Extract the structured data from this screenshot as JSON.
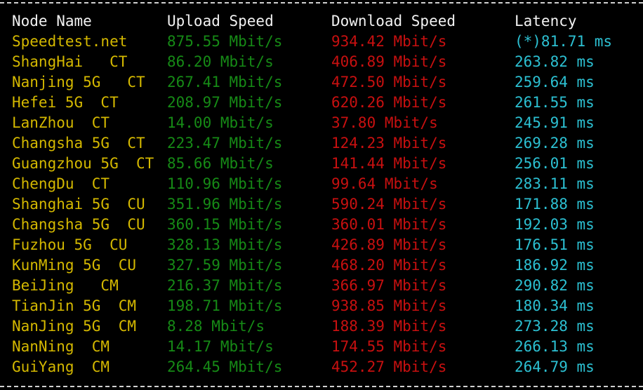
{
  "colors": {
    "node": "#d4b800",
    "upload": "#168a16",
    "download": "#c81010",
    "latency": "#2cc0d2",
    "header": "#f2f2f2"
  },
  "header": {
    "node": "Node Name",
    "upload": "Upload Speed",
    "download": "Download Speed",
    "latency": "Latency"
  },
  "rows": [
    {
      "node": "Speedtest.net",
      "upload": "875.55 Mbit/s",
      "download": "934.42 Mbit/s",
      "latency": "(*)81.71 ms"
    },
    {
      "node": "ShangHai   CT",
      "upload": "86.20 Mbit/s",
      "download": "406.89 Mbit/s",
      "latency": "263.82 ms"
    },
    {
      "node": "Nanjing 5G   CT",
      "upload": "267.41 Mbit/s",
      "download": "472.50 Mbit/s",
      "latency": "259.64 ms"
    },
    {
      "node": "Hefei 5G  CT",
      "upload": "208.97 Mbit/s",
      "download": "620.26 Mbit/s",
      "latency": "261.55 ms"
    },
    {
      "node": "LanZhou  CT",
      "upload": "14.00 Mbit/s",
      "download": "37.80 Mbit/s",
      "latency": "245.91 ms"
    },
    {
      "node": "Changsha 5G  CT",
      "upload": "223.47 Mbit/s",
      "download": "124.23 Mbit/s",
      "latency": "269.28 ms"
    },
    {
      "node": "Guangzhou 5G  CT",
      "upload": "85.66 Mbit/s",
      "download": "141.44 Mbit/s",
      "latency": "256.01 ms"
    },
    {
      "node": "ChengDu  CT",
      "upload": "110.96 Mbit/s",
      "download": "99.64 Mbit/s",
      "latency": "283.11 ms"
    },
    {
      "node": "Shanghai 5G  CU",
      "upload": "351.96 Mbit/s",
      "download": "590.24 Mbit/s",
      "latency": "171.88 ms"
    },
    {
      "node": "Changsha 5G  CU",
      "upload": "360.15 Mbit/s",
      "download": "360.01 Mbit/s",
      "latency": "192.03 ms"
    },
    {
      "node": "Fuzhou 5G  CU",
      "upload": "328.13 Mbit/s",
      "download": "426.89 Mbit/s",
      "latency": "176.51 ms"
    },
    {
      "node": "KunMing 5G  CU",
      "upload": "327.59 Mbit/s",
      "download": "468.20 Mbit/s",
      "latency": "186.92 ms"
    },
    {
      "node": "BeiJing   CM",
      "upload": "216.37 Mbit/s",
      "download": "366.97 Mbit/s",
      "latency": "290.82 ms"
    },
    {
      "node": "TianJin 5G  CM",
      "upload": "198.71 Mbit/s",
      "download": "938.85 Mbit/s",
      "latency": "180.34 ms"
    },
    {
      "node": "NanJing 5G  CM",
      "upload": "8.28 Mbit/s",
      "download": "188.39 Mbit/s",
      "latency": "273.28 ms"
    },
    {
      "node": "NanNing  CM",
      "upload": "14.17 Mbit/s",
      "download": "174.55 Mbit/s",
      "latency": "266.13 ms"
    },
    {
      "node": "GuiYang  CM",
      "upload": "264.45 Mbit/s",
      "download": "452.27 Mbit/s",
      "latency": "264.79 ms"
    }
  ]
}
